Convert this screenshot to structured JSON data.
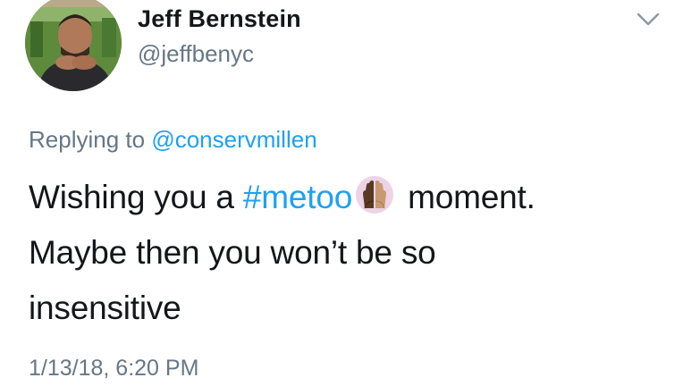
{
  "author": {
    "display_name": "Jeff Bernstein",
    "handle": "@jeffbenyc"
  },
  "reply": {
    "prefix": "Replying to ",
    "mention": "@conservmillen"
  },
  "tweet": {
    "text_part1": "Wishing you a ",
    "hashtag": "#metoo",
    "emoji_icon": "raised-hands-icon",
    "text_part2": " moment.",
    "line2": "Maybe then you won’t be so",
    "line3": "insensitive"
  },
  "timestamp": "1/13/18, 6:20 PM",
  "colors": {
    "link": "#1da1f2",
    "secondary_text": "#657786",
    "primary_text": "#14171a",
    "background": "#ffffff"
  }
}
